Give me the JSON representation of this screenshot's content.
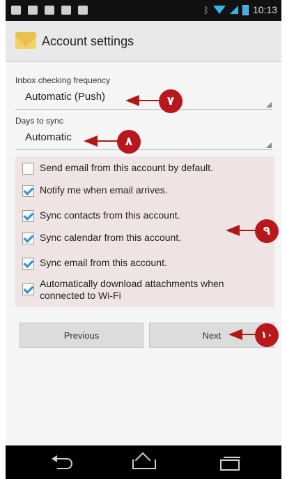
{
  "status_bar": {
    "time": "10:13",
    "icons": [
      "mail-icon",
      "facebook-icon",
      "sim-icon",
      "download-icon",
      "gamepad-icon",
      "bluetooth-icon",
      "wifi-icon",
      "signal-icon",
      "battery-icon"
    ],
    "accent": "#33b5e5"
  },
  "action_bar": {
    "title": "Account settings",
    "icon": "email-app-icon"
  },
  "form": {
    "inbox_label": "Inbox checking frequency",
    "inbox_value": "Automatic (Push)",
    "days_label": "Days to sync",
    "days_value": "Automatic"
  },
  "options": [
    {
      "label": "Send email from this account by default.",
      "checked": false
    },
    {
      "label": "Notify me when email arrives.",
      "checked": true
    },
    {
      "label": "Sync contacts from this account.",
      "checked": true
    },
    {
      "label": "Sync calendar from this account.",
      "checked": true
    },
    {
      "label": "Sync email from this account.",
      "checked": true
    },
    {
      "label": "Automatically download attachments when connected to Wi-Fi",
      "checked": true
    }
  ],
  "buttons": {
    "previous": "Previous",
    "next": "Next"
  },
  "callouts": {
    "c7": "٧",
    "c8": "٨",
    "c9": "٩",
    "c10": "١٠",
    "color": "#b8171c"
  },
  "nav_bar": {
    "icons": [
      "back-icon",
      "home-icon",
      "recent-apps-icon"
    ]
  }
}
